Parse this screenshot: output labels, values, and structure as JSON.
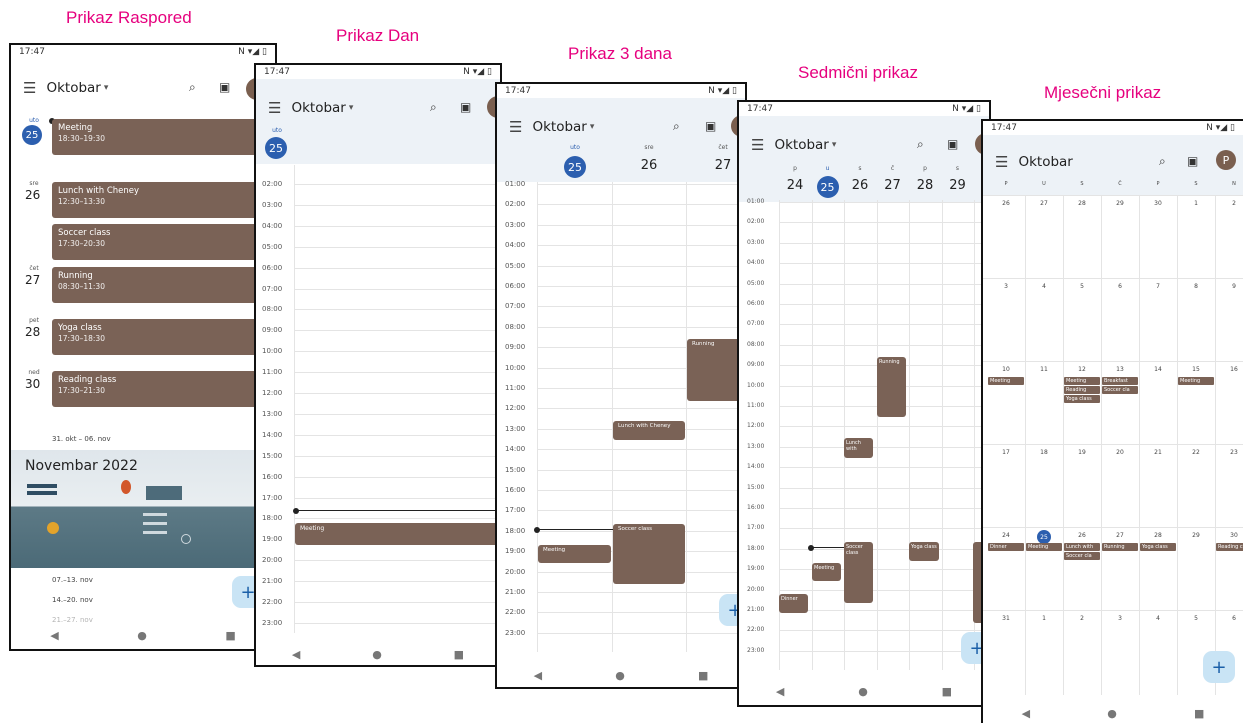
{
  "captions": {
    "schedule": "Prikaz Raspored",
    "day": "Prikaz Dan",
    "three_day": "Prikaz 3 dana",
    "week": "Sedmični prikaz",
    "month": "Mjesečni prikaz"
  },
  "status": {
    "time": "17:47",
    "gear": "⚙",
    "icons": "N ▾◢ ▯"
  },
  "month_title": "Oktobar",
  "dropdown": "▾",
  "avatar_letter": "P",
  "nav": {
    "back": "◀",
    "home": "●",
    "recent": "■"
  },
  "fab": "+",
  "schedule": {
    "days": [
      {
        "dow": "uto",
        "num": "25",
        "today": true,
        "events": [
          {
            "title": "Meeting",
            "time": "18:30–19:30"
          }
        ]
      },
      {
        "dow": "sre",
        "num": "26",
        "events": [
          {
            "title": "Lunch with Cheney",
            "time": "12:30–13:30"
          },
          {
            "title": "Soccer class",
            "time": "17:30–20:30"
          }
        ]
      },
      {
        "dow": "čet",
        "num": "27",
        "events": [
          {
            "title": "Running",
            "time": "08:30–11:30"
          }
        ]
      },
      {
        "dow": "pet",
        "num": "28",
        "events": [
          {
            "title": "Yoga class",
            "time": "17:30–18:30"
          }
        ]
      },
      {
        "dow": "ned",
        "num": "30",
        "events": [
          {
            "title": "Reading class",
            "time": "17:30–21:30"
          }
        ]
      }
    ],
    "week_range": "31. okt – 06. nov",
    "banner_title": "Novembar 2022",
    "ranges": [
      "07.–13. nov",
      "14.–20. nov",
      "21.–27. nov"
    ]
  },
  "day_view": {
    "dow": "uto",
    "num": "25",
    "hours": [
      "02:00",
      "03:00",
      "04:00",
      "05:00",
      "06:00",
      "07:00",
      "08:00",
      "09:00",
      "10:00",
      "11:00",
      "12:00",
      "13:00",
      "14:00",
      "15:00",
      "16:00",
      "17:00",
      "18:00",
      "19:00",
      "20:00",
      "21:00",
      "22:00",
      "23:00"
    ],
    "event": "Meeting"
  },
  "three_day": {
    "days": [
      {
        "dow": "uto",
        "num": "25"
      },
      {
        "dow": "sre",
        "num": "26"
      },
      {
        "dow": "čet",
        "num": "27"
      }
    ],
    "hours": [
      "01:00",
      "02:00",
      "03:00",
      "04:00",
      "05:00",
      "06:00",
      "07:00",
      "08:00",
      "09:00",
      "10:00",
      "11:00",
      "12:00",
      "13:00",
      "14:00",
      "15:00",
      "16:00",
      "17:00",
      "18:00",
      "19:00",
      "20:00",
      "21:00",
      "22:00",
      "23:00"
    ],
    "events": {
      "running": "Running",
      "lunch": "Lunch with Cheney",
      "meeting": "Meeting",
      "soccer": "Soccer class"
    }
  },
  "week": {
    "days": [
      {
        "dow": "p",
        "num": "24"
      },
      {
        "dow": "u",
        "num": "25"
      },
      {
        "dow": "s",
        "num": "26"
      },
      {
        "dow": "č",
        "num": "27"
      },
      {
        "dow": "p",
        "num": "28"
      },
      {
        "dow": "s",
        "num": "29"
      }
    ],
    "hours": [
      "01:00",
      "02:00",
      "03:00",
      "04:00",
      "05:00",
      "06:00",
      "07:00",
      "08:00",
      "09:00",
      "10:00",
      "11:00",
      "12:00",
      "13:00",
      "14:00",
      "15:00",
      "16:00",
      "17:00",
      "18:00",
      "19:00",
      "20:00",
      "21:00",
      "22:00",
      "23:00"
    ],
    "events": {
      "running": "Running",
      "lunch": "Lunch with",
      "soccer": "Soccer class",
      "meeting": "Meeting",
      "yoga": "Yoga class",
      "dinner": "Dinner"
    }
  },
  "month": {
    "dows": [
      "P",
      "U",
      "S",
      "Č",
      "P",
      "S",
      "N"
    ],
    "weeks": [
      [
        "26",
        "27",
        "28",
        "29",
        "30",
        "1",
        "2"
      ],
      [
        "3",
        "4",
        "5",
        "6",
        "7",
        "8",
        "9"
      ],
      [
        "10",
        "11",
        "12",
        "13",
        "14",
        "15",
        "16"
      ],
      [
        "17",
        "18",
        "19",
        "20",
        "21",
        "22",
        "23"
      ],
      [
        "24",
        "25",
        "26",
        "27",
        "28",
        "29",
        "30"
      ],
      [
        "31",
        "1",
        "2",
        "3",
        "4",
        "5",
        "6"
      ]
    ],
    "events": {
      "w2": [
        [
          "Meeting"
        ],
        [],
        [
          "Meeting",
          "Reading",
          "Yoga class"
        ],
        [
          "Breakfast",
          "Soccer cla"
        ],
        [],
        [
          "Meeting"
        ],
        []
      ],
      "w4": [
        [
          "Dinner"
        ],
        [
          "Meeting"
        ],
        [
          "Lunch with",
          "Soccer cla"
        ],
        [
          "Running"
        ],
        [
          "Yoga class"
        ],
        [],
        [
          "Reading cl"
        ]
      ]
    }
  }
}
